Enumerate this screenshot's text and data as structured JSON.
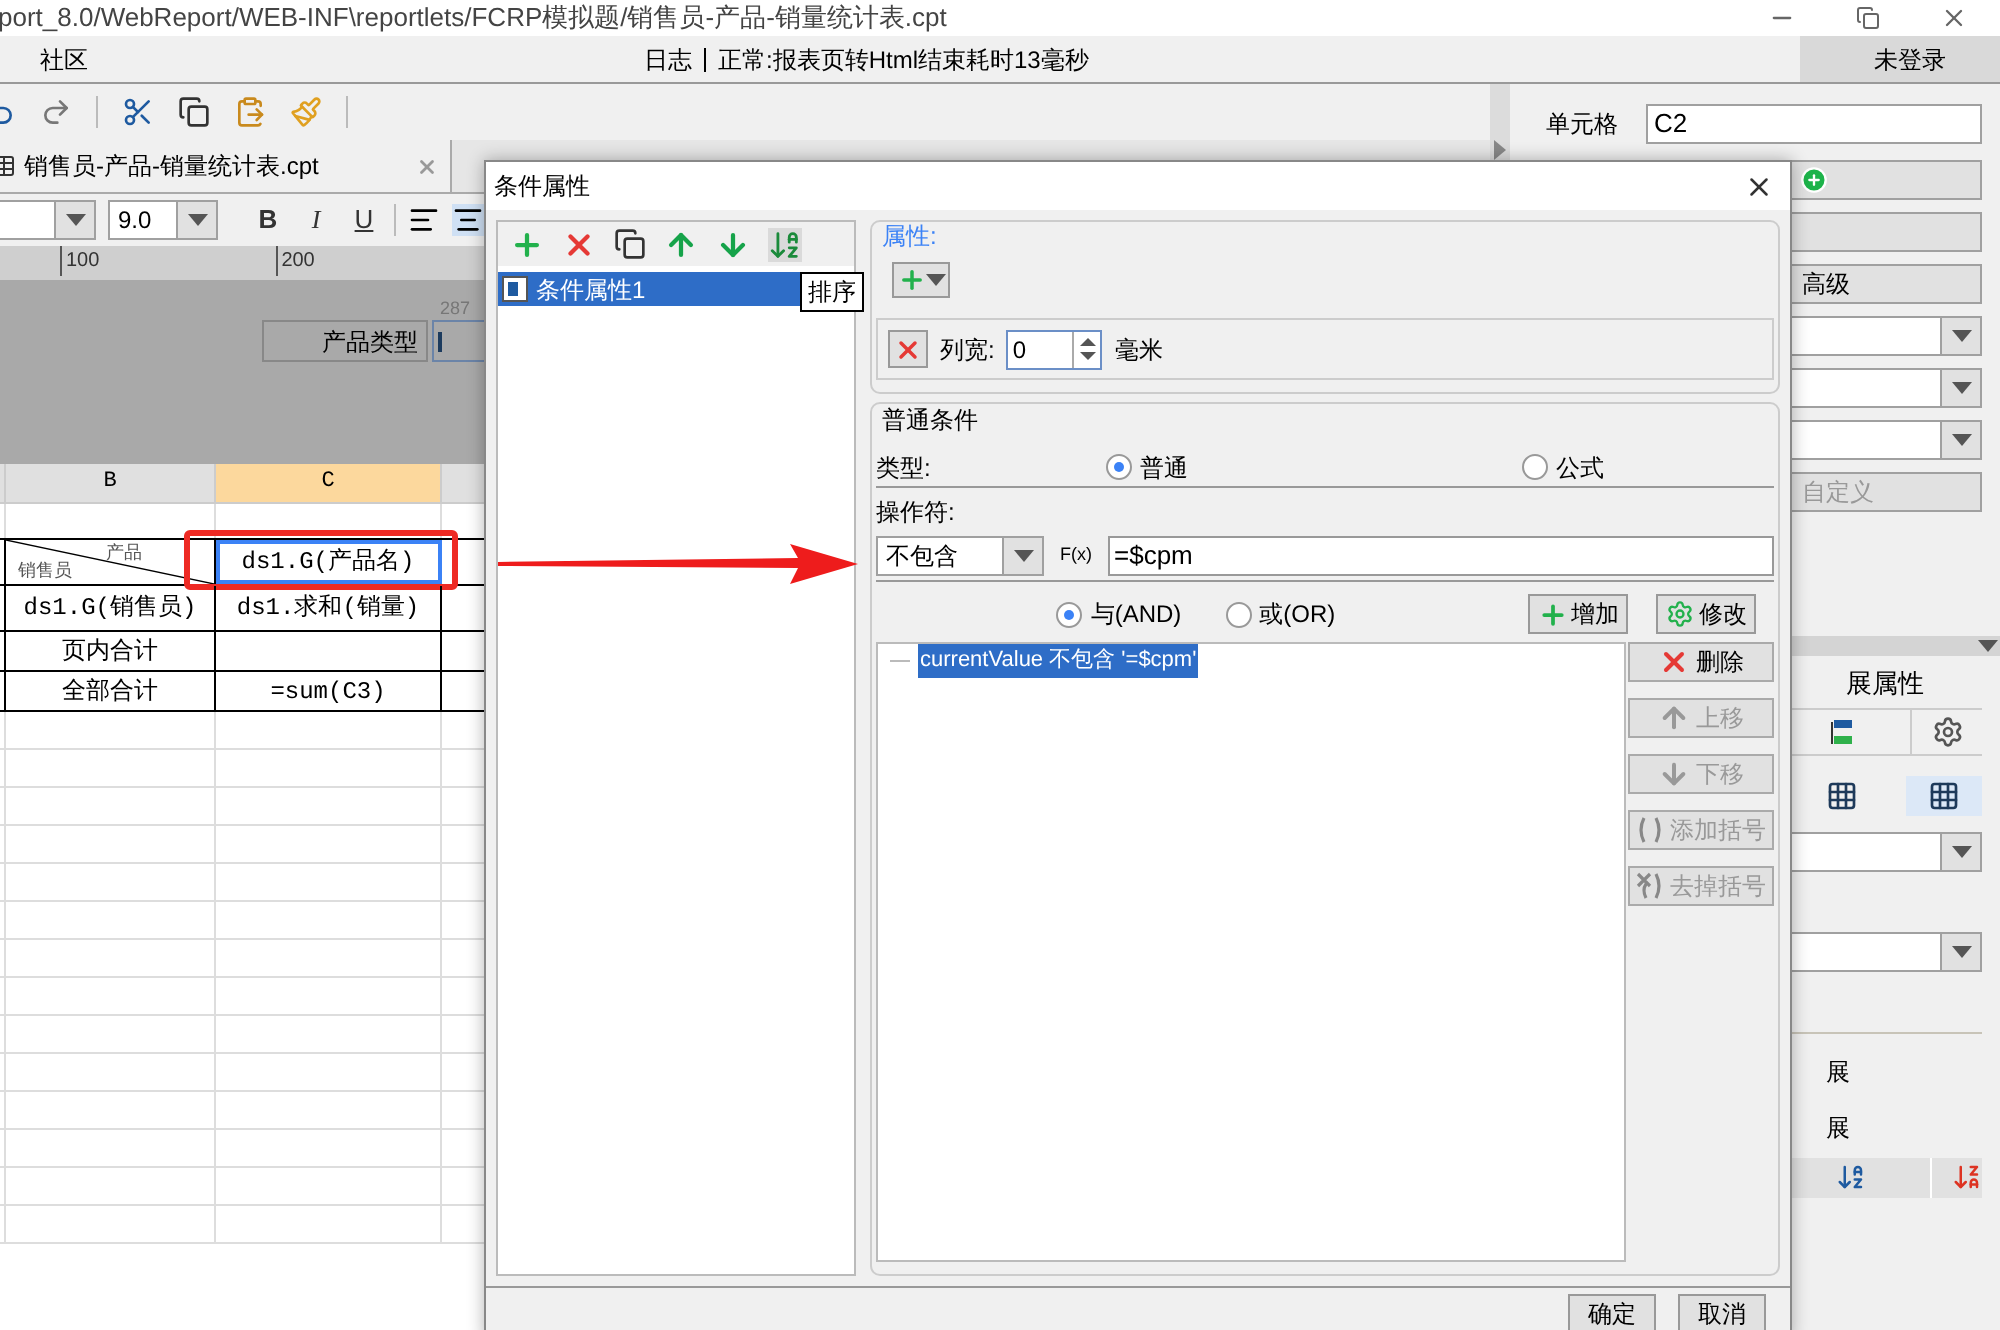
{
  "title_bar": {
    "path": "port_8.0/WebReport/WEB-INF\\reportlets/FCRP模拟题/销售员-产品-销量统计表.cpt"
  },
  "menu_bar": {
    "community": "社区",
    "log": "日志",
    "status": "正常:报表页转Html结束耗时13毫秒",
    "user": "未登录"
  },
  "tab": {
    "label": "销售员-产品-销量统计表.cpt"
  },
  "format_bar": {
    "font_size": "9.0",
    "bold": "B",
    "italic": "I",
    "underline": "U"
  },
  "ruler": {
    "ticks": [
      "100",
      "200"
    ]
  },
  "parameter_panel": {
    "label": "产品类型",
    "hint": "287"
  },
  "sheet": {
    "columns": [
      {
        "label": "B",
        "selected": false
      },
      {
        "label": "C",
        "selected": true
      }
    ],
    "rows": [
      {
        "cells": [
          {
            "kind": "diagonal",
            "top": "产品",
            "bottom": "销售员",
            "selected": false
          },
          {
            "kind": "text",
            "text": "ds1.G(产品名)",
            "selected": true
          }
        ]
      },
      {
        "cells": [
          {
            "kind": "text",
            "text": "ds1.G(销售员)",
            "selected": false
          },
          {
            "kind": "text",
            "text": "ds1.求和(销量)",
            "selected": false
          }
        ]
      },
      {
        "cells": [
          {
            "kind": "text",
            "text": "页内合计",
            "selected": false
          },
          {
            "kind": "empty",
            "selected": false
          }
        ]
      },
      {
        "cells": [
          {
            "kind": "text",
            "text": "全部合计",
            "selected": false
          },
          {
            "kind": "text",
            "text": "=sum(C3)",
            "selected": false
          }
        ]
      }
    ]
  },
  "right_panel": {
    "cell_label": "单元格",
    "cell_value": "C2",
    "advanced": "高级",
    "custom": "自定义",
    "section": "展属性",
    "expand_labels": [
      "展",
      "展"
    ]
  },
  "dialog": {
    "title": "条件属性",
    "list_items": [
      {
        "label": "条件属性1",
        "selected": true
      }
    ],
    "tooltip": "排序",
    "properties": {
      "legend": "属性:",
      "column_width_label": "列宽:",
      "column_width_value": "0",
      "unit": "毫米"
    },
    "condition": {
      "legend": "普通条件",
      "type_label": "类型:",
      "types": [
        {
          "label": "普通",
          "selected": true
        },
        {
          "label": "公式",
          "selected": false
        }
      ],
      "operator_label": "操作符:",
      "operator": "不包含",
      "fx": "F(x)",
      "value": "=$cpm",
      "joins": [
        {
          "label": "与(AND)",
          "selected": true
        },
        {
          "label": "或(OR)",
          "selected": false
        }
      ],
      "add": "增加",
      "modify": "修改",
      "entries": [
        {
          "text": "currentValue 不包含 '=$cpm'",
          "selected": true
        }
      ],
      "side_buttons": [
        {
          "kind": "delete",
          "label": "删除",
          "disabled": false
        },
        {
          "kind": "up",
          "label": "上移",
          "disabled": true
        },
        {
          "kind": "down",
          "label": "下移",
          "disabled": true
        },
        {
          "kind": "add_bracket",
          "label": "添加括号",
          "disabled": true
        },
        {
          "kind": "remove_bracket",
          "label": "去掉括号",
          "disabled": true
        }
      ]
    },
    "buttons": [
      "确定",
      "取消"
    ]
  }
}
